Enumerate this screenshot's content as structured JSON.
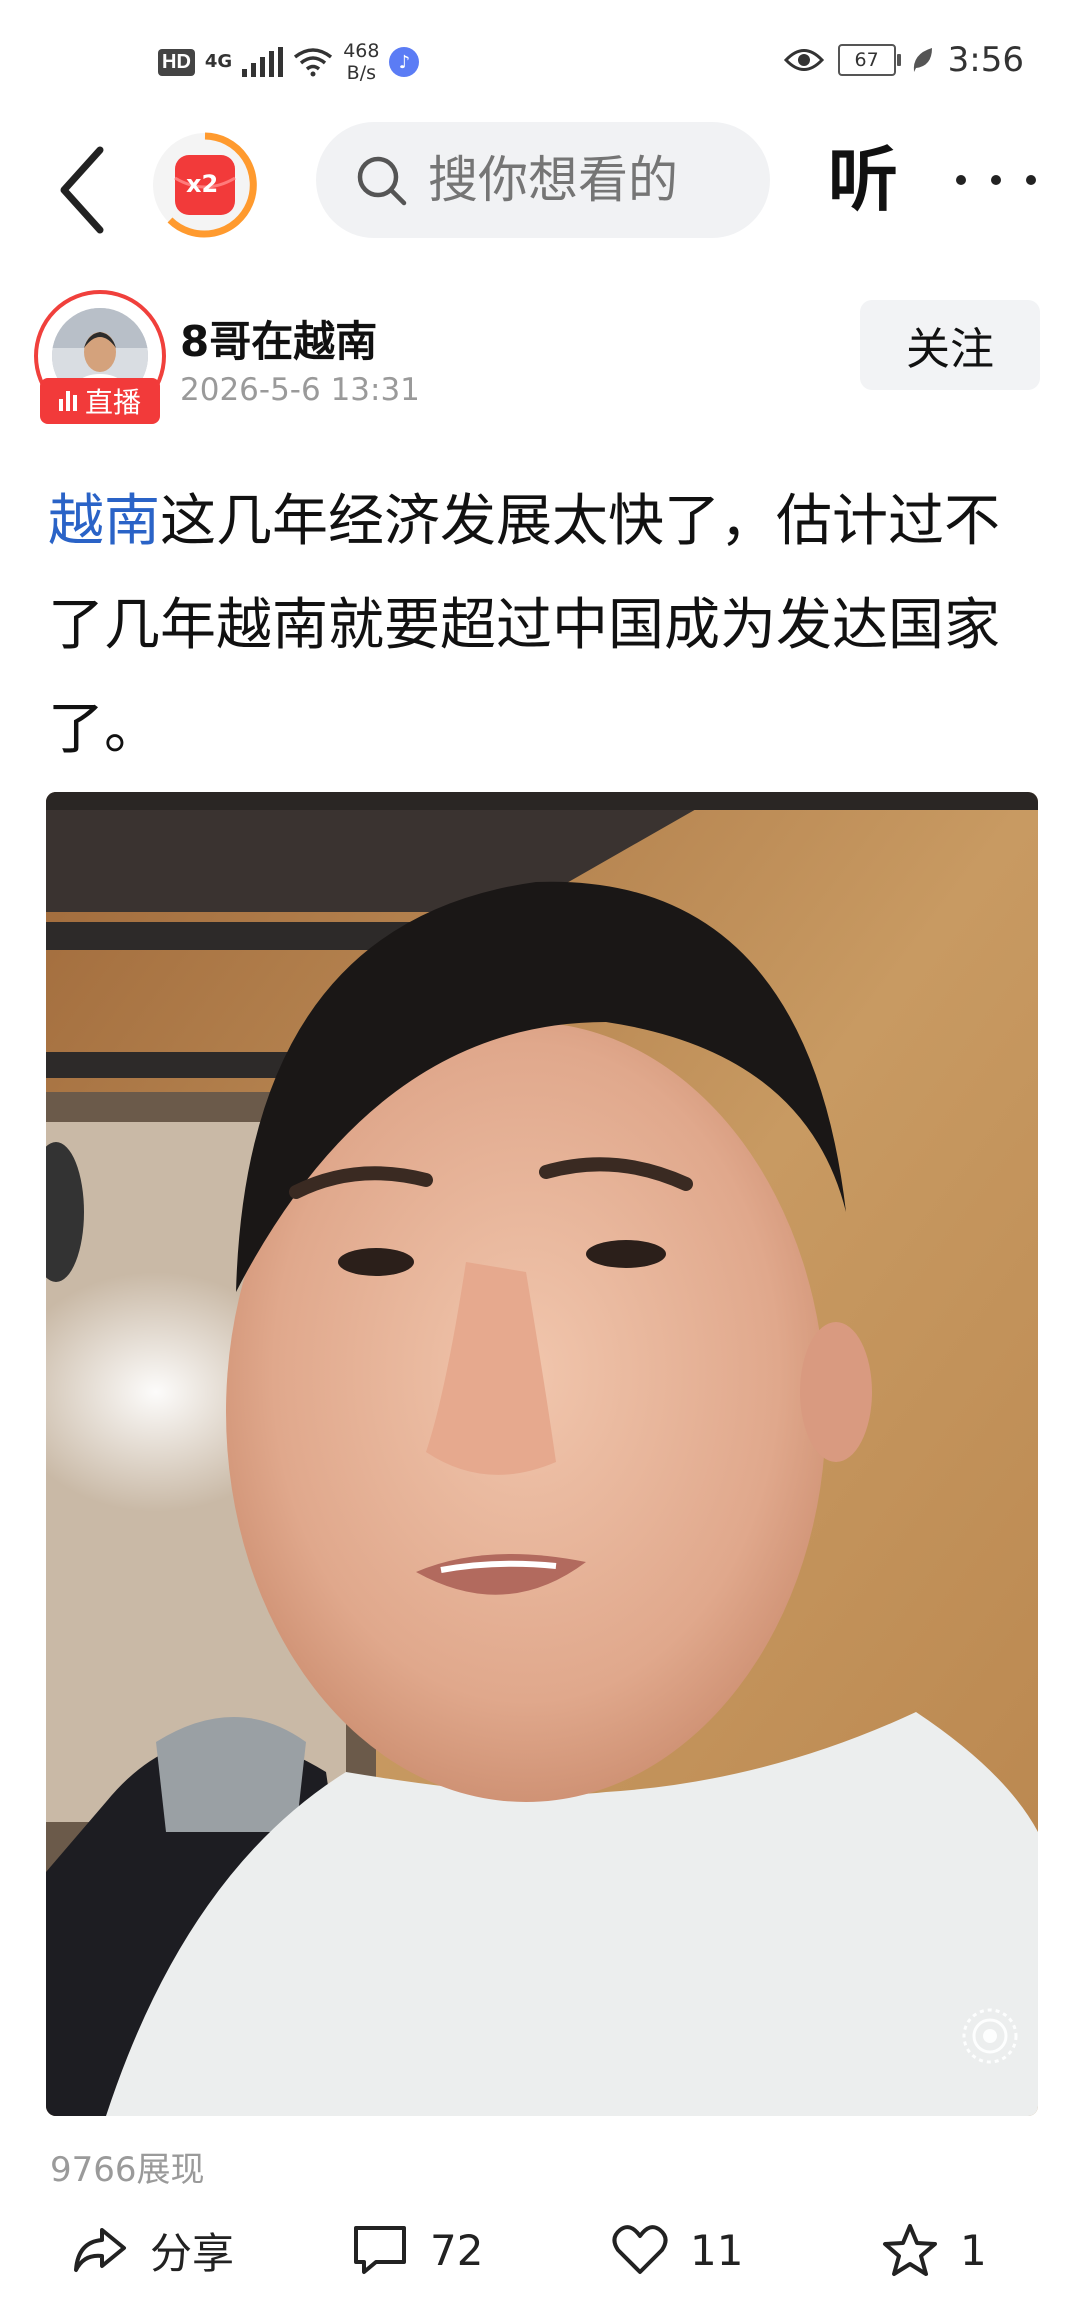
{
  "status_bar": {
    "hd": "HD",
    "network": "4G",
    "net_speed_value": "468",
    "net_speed_unit": "B/s",
    "battery": "67",
    "time": "3:56"
  },
  "nav": {
    "badge": "x2",
    "search_placeholder": "搜你想看的",
    "listen_label": "听"
  },
  "author": {
    "name": "8哥在越南",
    "time": "2026-5-6 13:31",
    "live_label": "直播",
    "follow_label": "关注"
  },
  "post": {
    "topic": "越南",
    "text": "这几年经济发展太快了，估计过不了几年越南就要超过中国成为发达国家了。",
    "views": "9766展现"
  },
  "actions": {
    "share_label": "分享",
    "comments": "72",
    "likes": "11",
    "favorites": "1"
  }
}
